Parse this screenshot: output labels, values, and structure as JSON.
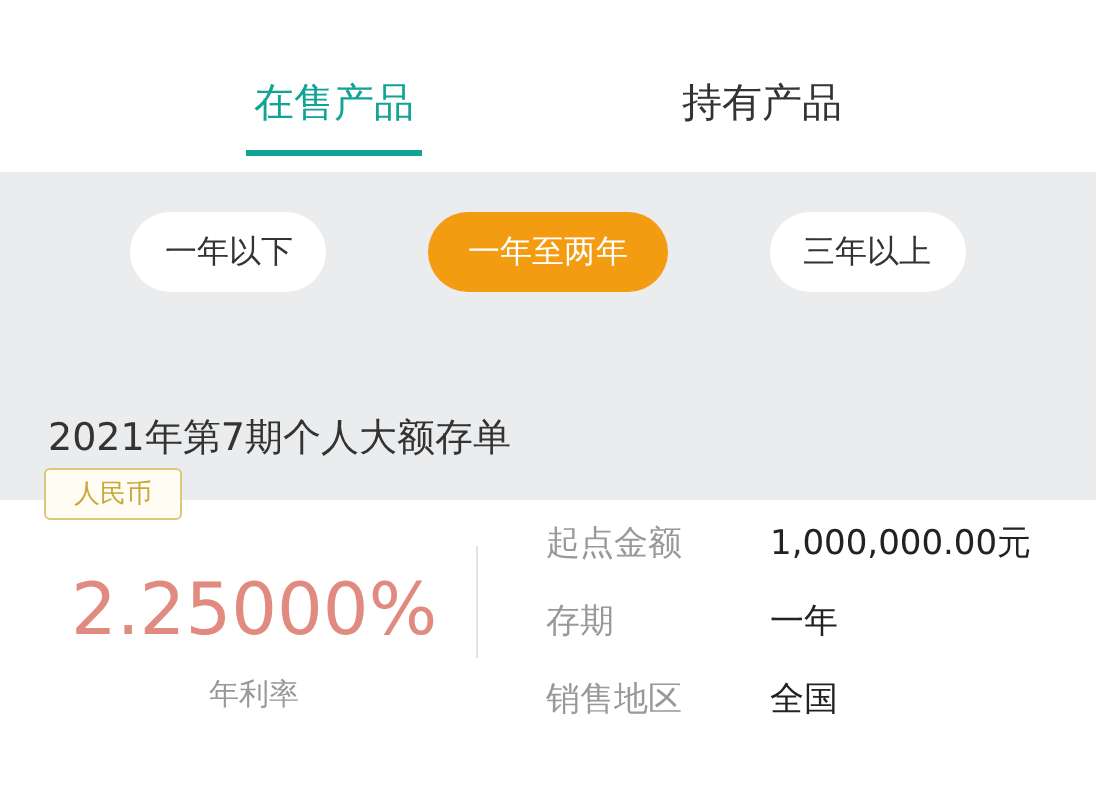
{
  "tabs": [
    {
      "label": "在售产品",
      "selected": true
    },
    {
      "label": "持有产品",
      "selected": false
    }
  ],
  "filters": [
    {
      "label": "一年以下",
      "selected": false
    },
    {
      "label": "一年至两年",
      "selected": true
    },
    {
      "label": "三年以上",
      "selected": false
    }
  ],
  "product": {
    "title": "2021年第7期个人大额存单",
    "currency": "人民币",
    "rate": "2.25000%",
    "rate_label": "年利率",
    "details": [
      {
        "label": "起点金额",
        "value": "1,000,000.00元"
      },
      {
        "label": "存期",
        "value": "一年"
      },
      {
        "label": "销售地区",
        "value": "全国"
      }
    ]
  }
}
